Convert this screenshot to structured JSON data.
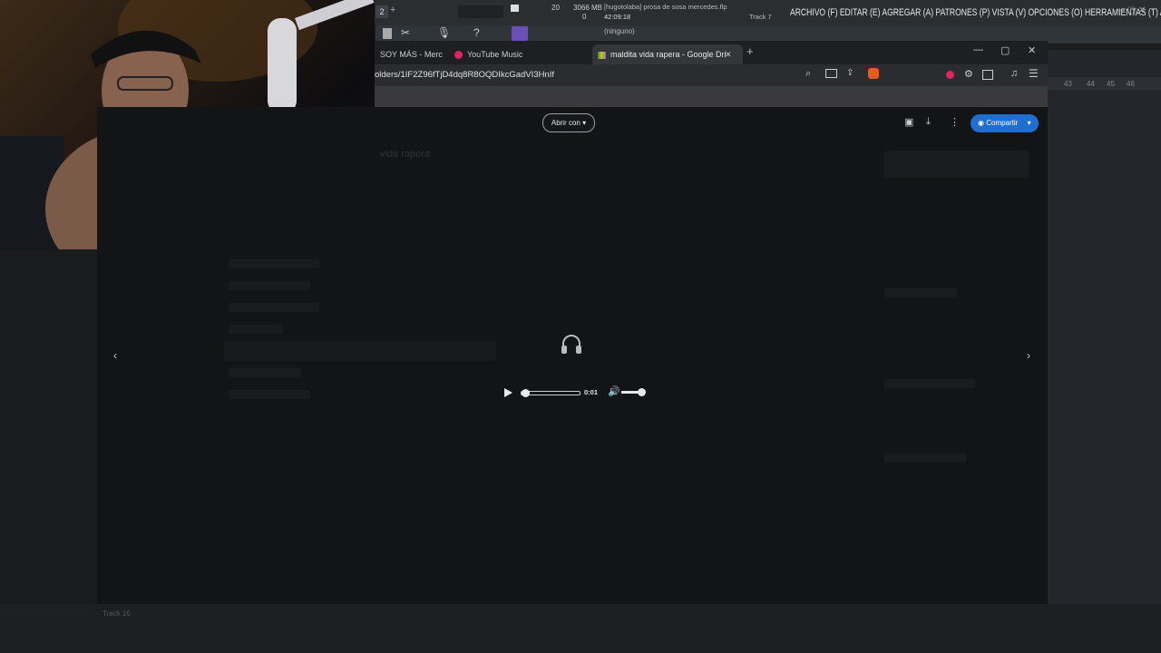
{
  "fl_studio": {
    "menu": "ARCHIVO (F) EDITAR (E) AGREGAR (A) PATRONES (P) VISTA (V) OPCIONES (O) HERRAMIENTAS (T) AYUDA",
    "project_hint": "[hugotolaba] prosa de sosa mercedes.flp",
    "time": "42:09:18",
    "cpu_value": "20",
    "memory": "3066 MB",
    "voices": "0",
    "track_label": "Track 7",
    "pattern_num": "2",
    "channel_label": "(ninguno)",
    "bottom_track": "Track 16",
    "timeline_nums": [
      "43",
      "44",
      "45",
      "46"
    ]
  },
  "browser": {
    "tabs": [
      {
        "label": "SOY MÁS - Merc",
        "active": false
      },
      {
        "label": "YouTube Music",
        "active": false
      },
      {
        "label": "maldita vida rapera - Google Dri",
        "active": true
      }
    ],
    "address": "olders/1IF2Z96fTjD4dq8R8OQDIkcGadVI3HnIf",
    "window_controls": {
      "minimize": "—",
      "maximize": "▢",
      "close": "✕"
    }
  },
  "drive": {
    "open_with_label": "Abrir con",
    "share_label": "Compartir",
    "folder_title": "vida rapera"
  },
  "player": {
    "time": "0:01",
    "progress_fraction": 0.06,
    "volume_fraction": 1.0
  },
  "colors": {
    "accent_blue": "#1f6fd1",
    "record_red": "#e0245e"
  },
  "icons": {
    "headphones": "headphones-icon",
    "play": "play-icon",
    "volume": "volume-icon",
    "prev": "chevron-left-icon",
    "next": "chevron-right-icon"
  }
}
